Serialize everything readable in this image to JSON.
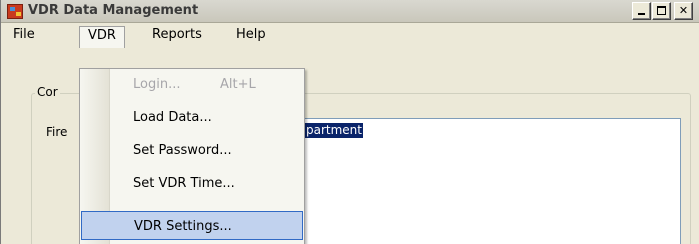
{
  "window": {
    "title": "VDR Data Management"
  },
  "menubar": {
    "items": [
      {
        "label": "File"
      },
      {
        "label": "VDR"
      },
      {
        "label": "Reports"
      },
      {
        "label": "Help"
      }
    ]
  },
  "vdr_menu": {
    "items": [
      {
        "label": "Login...",
        "shortcut": "Alt+L",
        "enabled": false
      },
      {
        "label": "Load Data...",
        "shortcut": "",
        "enabled": true
      },
      {
        "label": "Set Password...",
        "shortcut": "",
        "enabled": true
      },
      {
        "label": "Set VDR Time...",
        "shortcut": "",
        "enabled": true
      },
      {
        "label": "VDR Settings...",
        "shortcut": "",
        "enabled": true,
        "highlighted": true
      }
    ]
  },
  "main": {
    "group_title": "Cor",
    "field_label": "Fire",
    "field_selected_text": "partment"
  },
  "colors": {
    "selection_bg": "#0a246a",
    "menu_highlight_bg": "#c1d2ee",
    "menu_highlight_border": "#316ac5"
  }
}
